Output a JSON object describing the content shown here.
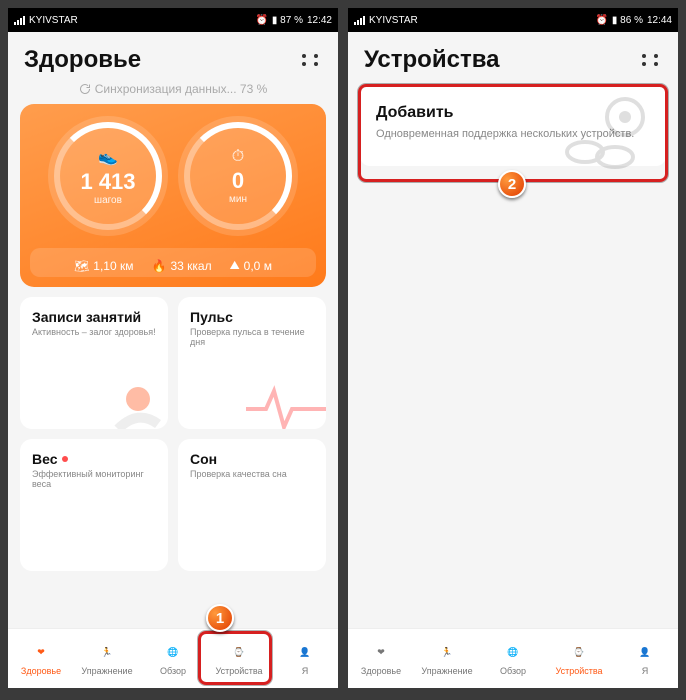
{
  "left": {
    "status": {
      "carrier": "KYIVSTAR",
      "alarm": "⏰",
      "battery": "87 %",
      "time": "12:42"
    },
    "title": "Здоровье",
    "sync": "Синхронизация данных... 73 %",
    "steps": {
      "value": "1 413",
      "label": "шагов"
    },
    "minutes": {
      "value": "0",
      "label": "мин"
    },
    "stats": {
      "distance": "1,10 км",
      "kcal": "33 ккал",
      "climb": "0,0 м"
    },
    "tiles": [
      {
        "title": "Записи занятий",
        "sub": "Активность – залог здоровья!"
      },
      {
        "title": "Пульс",
        "sub": "Проверка пульса в течение дня"
      },
      {
        "title": "Вес",
        "sub": "Эффективный мониторинг веса",
        "dot": true
      },
      {
        "title": "Сон",
        "sub": "Проверка качества сна"
      }
    ],
    "nav": [
      "Здоровье",
      "Упражнение",
      "Обзор",
      "Устройства",
      "Я"
    ],
    "badge": "1"
  },
  "right": {
    "status": {
      "carrier": "KYIVSTAR",
      "alarm": "⏰",
      "battery": "86 %",
      "time": "12:44"
    },
    "title": "Устройства",
    "add": {
      "title": "Добавить",
      "sub": "Одновременная поддержка нескольких устройств."
    },
    "nav": [
      "Здоровье",
      "Упражнение",
      "Обзор",
      "Устройства",
      "Я"
    ],
    "badge": "2"
  }
}
